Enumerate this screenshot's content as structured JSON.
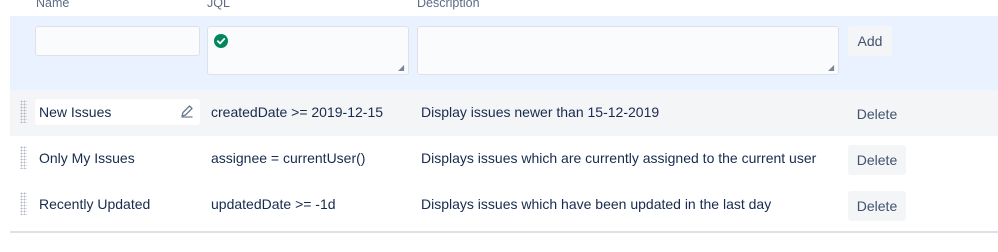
{
  "headers": {
    "name": "Name",
    "jql": "JQL",
    "description": "Description"
  },
  "add_form": {
    "name_value": "",
    "jql_value": "",
    "description_value": "",
    "add_label": "Add",
    "jql_status": "valid"
  },
  "filters": [
    {
      "name": "New Issues",
      "jql": "createdDate >= 2019-12-15",
      "description": "Display issues newer than 15-12-2019",
      "delete_label": "Delete"
    },
    {
      "name": "Only My Issues",
      "jql": "assignee = currentUser()",
      "description": "Displays issues which are currently assigned to the current user",
      "delete_label": "Delete"
    },
    {
      "name": "Recently Updated",
      "jql": "updatedDate >= -1d",
      "description": "Displays issues which have been updated in the last day",
      "delete_label": "Delete"
    }
  ],
  "colors": {
    "add_row_bg": "#ebf2ff",
    "hover_row_bg": "#f4f5f7",
    "valid_green": "#00875a"
  }
}
